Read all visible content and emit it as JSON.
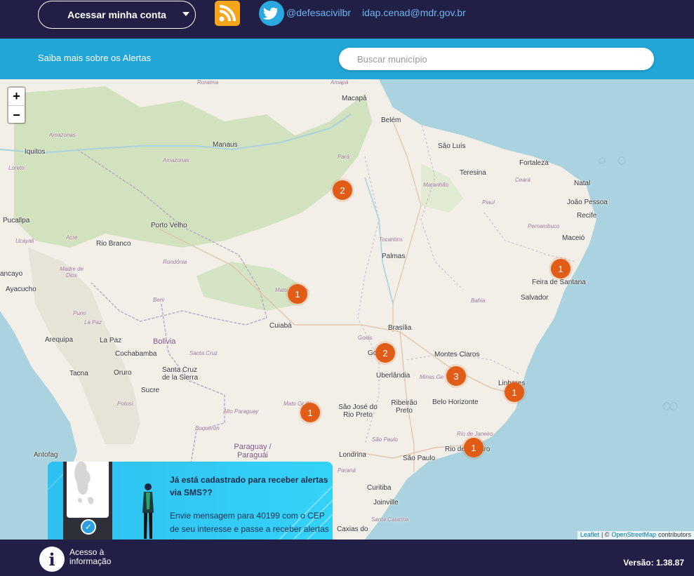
{
  "header": {
    "account_label": "Acessar minha conta",
    "twitter_handle": "@defesacivilbr",
    "email": "idap.cenad@mdr.gov.br"
  },
  "bluebar": {
    "saiba_mais": "Saiba mais sobre os Alertas",
    "search_placeholder": "Buscar município"
  },
  "map": {
    "zoom_in": "+",
    "zoom_out": "−",
    "attribution_leaflet": "Leaflet",
    "attribution_osm": "OpenStreetMap",
    "attribution_suffix": "contributors",
    "attribution_sep": "| ©",
    "markers": [
      {
        "count": "2",
        "location": "Pará"
      },
      {
        "count": "1",
        "location": "Mato Grosso"
      },
      {
        "count": "2",
        "location": "Goiânia"
      },
      {
        "count": "3",
        "location": "Minas Gerais"
      },
      {
        "count": "1",
        "location": "Feira de Santana"
      },
      {
        "count": "1",
        "location": "Vitória"
      },
      {
        "count": "1",
        "location": "Mato Grosso do Sul"
      },
      {
        "count": "1",
        "location": "Rio de Janeiro"
      }
    ],
    "labels": {
      "macapa": "Macapá",
      "belem": "Belém",
      "sao_luis": "São Luís",
      "fortaleza": "Fortaleza",
      "teresina": "Teresina",
      "natal": "Natal",
      "joao_pessoa": "João Pessoa",
      "recife": "Recife",
      "maceio": "Maceió",
      "feira": "Feira de Santana",
      "salvador": "Salvador",
      "manaus": "Manaus",
      "iquitos": "Iquitos",
      "loreto": "Loreto",
      "pucallpa": "Pucallpa",
      "porto_velho": "Porto Velho",
      "rio_branco": "Rio Branco",
      "palmas": "Palmas",
      "brasilia": "Brasília",
      "cuiaba": "Cuiabá",
      "goiania": "Go",
      "montes_claros": "Montes Claros",
      "uberlandia": "Uberlândia",
      "belo_horizonte": "Belo Horizonte",
      "linhares": "Linhares",
      "ribeirao": "Ribeirão Preto",
      "sao_jose": "São José do Rio Preto",
      "rio": "Rio de Janeiro",
      "sao_paulo": "São Paulo",
      "londrina": "Londrina",
      "curitiba": "Curitiba",
      "joinville": "Joinville",
      "caxias": "Caxias do",
      "bolivia": "Bolivia",
      "la_paz": "La Paz",
      "cochabamba": "Cochabamba",
      "santa_cruz": "Santa Cruz de la Sierra",
      "sucre": "Sucre",
      "oruro": "Oruro",
      "arequipa": "Arequipa",
      "tacna": "Tacna",
      "potosi": "Potosí",
      "ayacucho": "Ayacucho",
      "cancayo": "ancayo",
      "antofagasta": "Antofag",
      "paraguay": "Paraguay / Paraguái",
      "amazonas_r": "Amazonas",
      "amazonas_s": "Amazonas",
      "para": "Pará",
      "maranhao": "Maranhão",
      "piaui": "Piauí",
      "ceara": "Ceará",
      "pernambuco": "Pernambuco",
      "tocantins": "Tocantins",
      "bahia": "Bahia",
      "mato_grosso": "Mato Grosso",
      "rondonia": "Rondônia",
      "acre": "Acre",
      "ucayali": "Ucayali",
      "madre_de_dios": "Madre de Dios",
      "beni": "Beni",
      "goias": "Goiás",
      "minas_gerais": "Minas Ge",
      "mato_grosso_sul": "Mato Gr do",
      "alto_paraguay": "Alto Paraguay",
      "boqueron": "Boquerón",
      "parana": "Paraná",
      "santa_cruz_r": "Santa Cruz",
      "rio_janeiro_s": "Rio de Janeiro",
      "sao_paulo_s": "São Paulo",
      "santa_catarina": "Santa Catarina",
      "amapa": "Amapá",
      "roraima": "Roraima",
      "puno": "Puno",
      "la_paz_s": "La Paz"
    }
  },
  "sms": {
    "title": "Já está cadastrado para receber alertas via SMS??",
    "body": "Envie mensagem para 40199 com o CEP de seu interesse e passe a receber alertas de"
  },
  "footer": {
    "acesso": "Acesso à\ninformação",
    "version": "Versão: 1.38.87"
  },
  "colors": {
    "header_bg": "#221f46",
    "bluebar": "#22a6d8",
    "marker": "#e05c17",
    "rss": "#f7a51b",
    "twitter": "#2aa9e0",
    "link": "#6db5ef"
  }
}
